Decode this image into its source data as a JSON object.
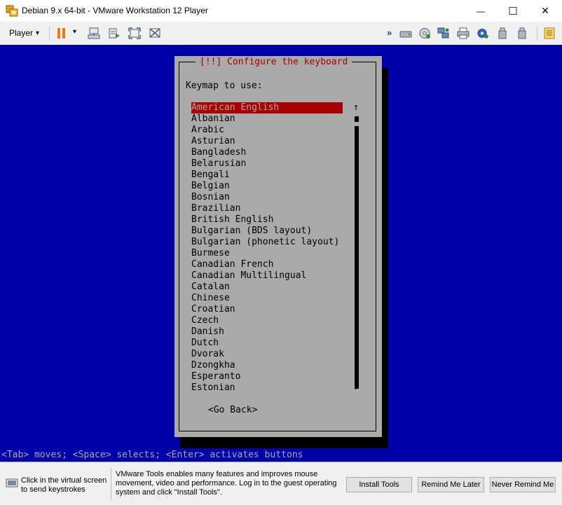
{
  "window": {
    "title": "Debian 9.x 64-bit - VMware Workstation 12 Player",
    "minimize": "—",
    "maximize": "☐",
    "close": "✕"
  },
  "toolbar": {
    "player_label": "Player",
    "player_arrow": "▾",
    "pause_arrow": "▾"
  },
  "installer": {
    "title_left": "[!!]",
    "title_text": "Configure the keyboard",
    "prompt": "Keymap to use:",
    "selected_index": 0,
    "keymaps": [
      "American English",
      "Albanian",
      "Arabic",
      "Asturian",
      "Bangladesh",
      "Belarusian",
      "Bengali",
      "Belgian",
      "Bosnian",
      "Brazilian",
      "British English",
      "Bulgarian (BDS layout)",
      "Bulgarian (phonetic layout)",
      "Burmese",
      "Canadian French",
      "Canadian Multilingual",
      "Catalan",
      "Chinese",
      "Croatian",
      "Czech",
      "Danish",
      "Dutch",
      "Dvorak",
      "Dzongkha",
      "Esperanto",
      "Estonian"
    ],
    "scroll_up": "↑",
    "scroll_down": "↓",
    "go_back": "<Go Back>",
    "status_line": "<Tab> moves; <Space> selects; <Enter> activates buttons"
  },
  "notification": {
    "hint": "Click in the virtual screen to send keystrokes",
    "message": "VMware Tools enables many features and improves mouse movement, video and performance. Log in to the guest operating system and click \"Install Tools\".",
    "install_label": "Install Tools",
    "remind_later_label": "Remind Me Later",
    "never_remind_label": "Never Remind Me"
  },
  "colors": {
    "vm_background": "#0000a8",
    "dialog_background": "#aaaaaa",
    "selection": "#a80000"
  }
}
